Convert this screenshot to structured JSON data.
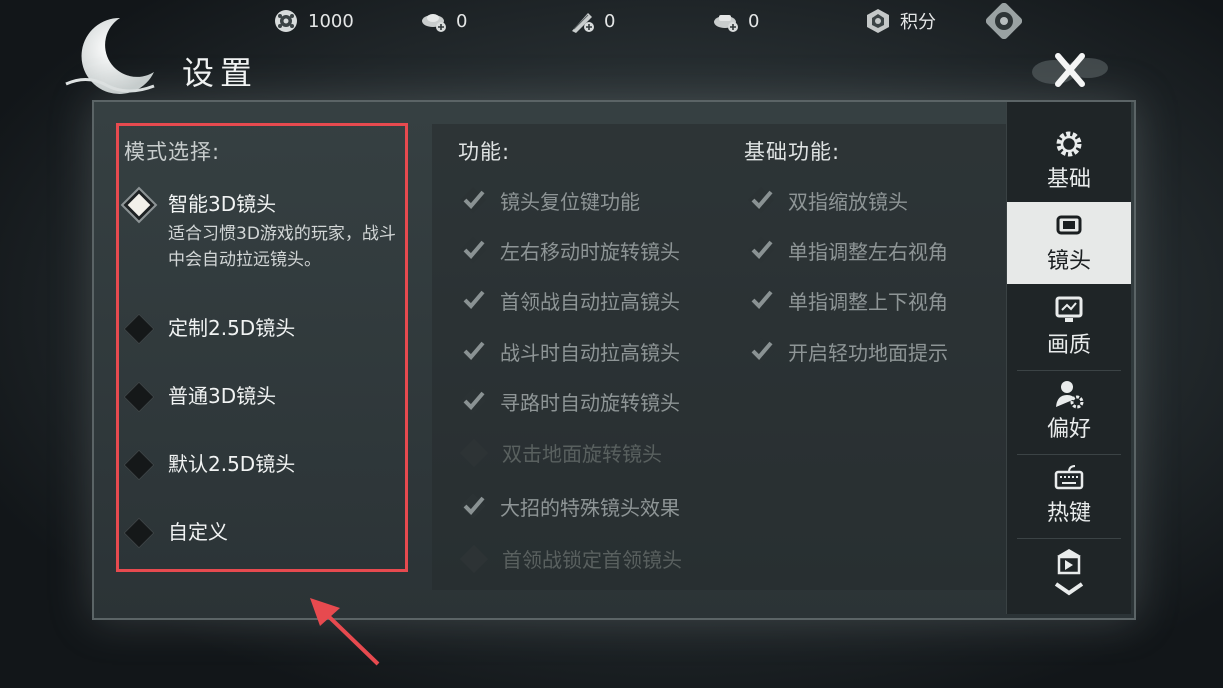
{
  "topbar": {
    "items": [
      {
        "icon": "coin-reel-icon",
        "value": "1000"
      },
      {
        "icon": "ingot-plus-icon",
        "value": "0"
      },
      {
        "icon": "feather-plus-icon",
        "value": "0"
      },
      {
        "icon": "treasure-plus-icon",
        "value": "0"
      },
      {
        "icon": "points-badge-icon",
        "value": "积分"
      }
    ],
    "settings_icon": "gear-badge-icon"
  },
  "dialog": {
    "title": "设置",
    "close_icon": "close-icon"
  },
  "mode": {
    "heading": "模式选择:",
    "options": [
      {
        "label": "智能3D镜头",
        "selected": true,
        "desc": "适合习惯3D游戏的玩家，战斗中会自动拉远镜头。"
      },
      {
        "label": "定制2.5D镜头",
        "selected": false
      },
      {
        "label": "普通3D镜头",
        "selected": false
      },
      {
        "label": "默认2.5D镜头",
        "selected": false
      },
      {
        "label": "自定义",
        "selected": false
      }
    ]
  },
  "features": {
    "heading": "功能:",
    "options": [
      {
        "label": "镜头复位键功能",
        "checked": true
      },
      {
        "label": "左右移动时旋转镜头",
        "checked": true
      },
      {
        "label": "首领战自动拉高镜头",
        "checked": true
      },
      {
        "label": "战斗时自动拉高镜头",
        "checked": true
      },
      {
        "label": "寻路时自动旋转镜头",
        "checked": true
      },
      {
        "label": "双击地面旋转镜头",
        "checked": false
      },
      {
        "label": "大招的特殊镜头效果",
        "checked": true
      },
      {
        "label": "首领战锁定首领镜头",
        "checked": false
      }
    ]
  },
  "basic": {
    "heading": "基础功能:",
    "options": [
      {
        "label": "双指缩放镜头",
        "checked": true
      },
      {
        "label": "单指调整左右视角",
        "checked": true
      },
      {
        "label": "单指调整上下视角",
        "checked": true
      },
      {
        "label": "开启轻功地面提示",
        "checked": true
      }
    ]
  },
  "tabs": {
    "items": [
      {
        "label": "基础",
        "icon": "gear-icon",
        "active": false
      },
      {
        "label": "镜头",
        "icon": "camera-frame-icon",
        "active": true
      },
      {
        "label": "画质",
        "icon": "monitor-icon",
        "active": false
      },
      {
        "label": "偏好",
        "icon": "user-settings-icon",
        "active": false
      },
      {
        "label": "热键",
        "icon": "keyboard-icon",
        "active": false
      },
      {
        "label": "",
        "icon": "shop-icon",
        "active": false
      }
    ],
    "more_icon": "chevron-down-icon"
  },
  "colors": {
    "highlight_box": "#e74a4f",
    "active_tab": "#e7e9e8",
    "panel": "#323b3e"
  }
}
